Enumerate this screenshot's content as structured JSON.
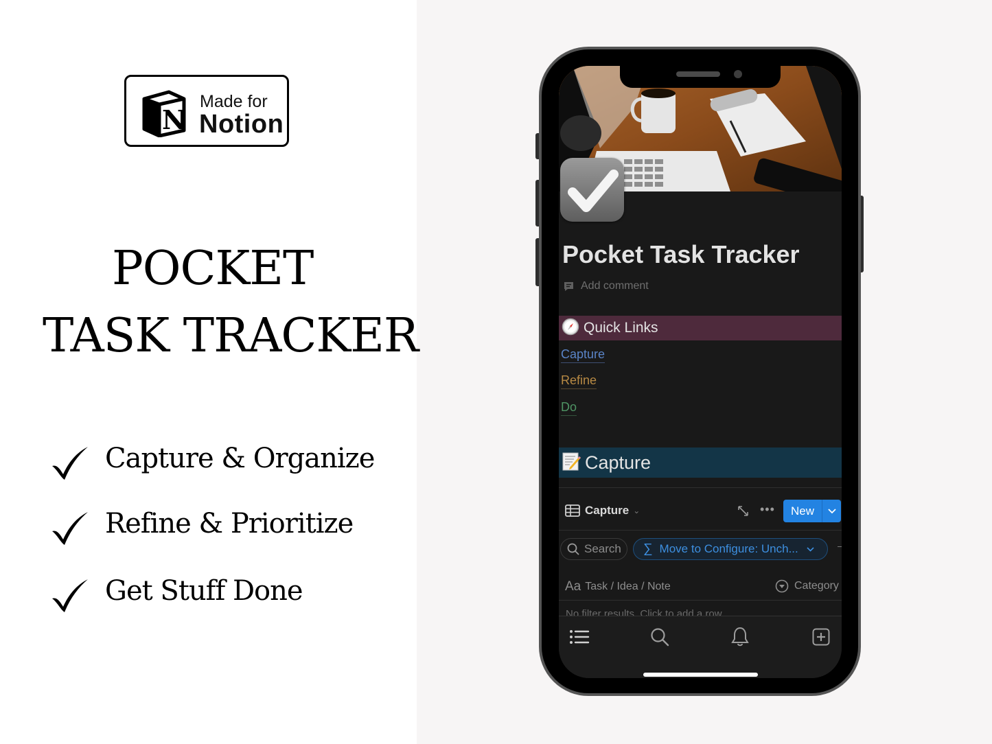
{
  "badge": {
    "line1": "Made for",
    "line2": "Notion",
    "logo_letter": "N"
  },
  "headline": {
    "line1": "POCKET",
    "line2": "TASK TRACKER"
  },
  "features": [
    {
      "icon": "checkmark-icon",
      "label": "Capture & Organize"
    },
    {
      "icon": "checkmark-icon",
      "label": "Refine & Prioritize"
    },
    {
      "icon": "checkmark-icon",
      "label": "Get Stuff Done"
    }
  ],
  "phone": {
    "page": {
      "cover": "desk-with-laptop-coffee-notepad-photo",
      "icon": "checkmark-icon",
      "title": "Pocket Task Tracker",
      "add_comment": "Add comment"
    },
    "quick_links": {
      "emoji": "🧭",
      "heading": "Quick Links",
      "links": [
        {
          "label": "Capture",
          "color": "#5a84c7"
        },
        {
          "label": "Refine",
          "color": "#b88a44"
        },
        {
          "label": "Do",
          "color": "#4f9464"
        }
      ],
      "background": "#4e2a3c"
    },
    "capture_section": {
      "emoji": "📝",
      "heading": "Capture",
      "background": "#133547"
    },
    "database": {
      "view_icon": "table-icon",
      "view_name": "Capture",
      "new_button": "New",
      "search_label": "Search",
      "filter_label": "Move to Configure: Unch...",
      "columns": [
        {
          "icon": "text-icon",
          "icon_text": "Aa",
          "label": "Task / Idea / Note"
        },
        {
          "icon": "select-icon",
          "label": "Category"
        }
      ],
      "empty_message": "No filter results. Click to add a row.",
      "accent": "#2383e2"
    },
    "tabbar": [
      {
        "icon": "list-icon"
      },
      {
        "icon": "search-icon"
      },
      {
        "icon": "bell-icon"
      },
      {
        "icon": "add-page-icon"
      }
    ]
  }
}
